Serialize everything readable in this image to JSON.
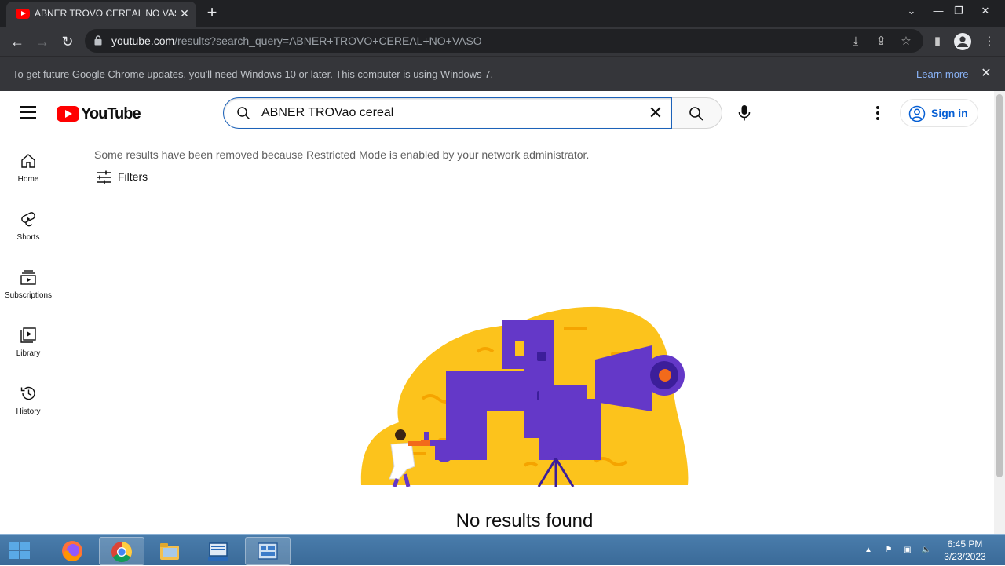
{
  "browser": {
    "tab_title": "ABNER TROVO CEREAL NO VASO",
    "url_domain": "youtube.com",
    "url_path": "/results?search_query=ABNER+TROVO+CEREAL+NO+VASO",
    "infobar_message": "To get future Google Chrome updates, you'll need Windows 10 or later. This computer is using Windows 7.",
    "infobar_link": "Learn more"
  },
  "youtube": {
    "logo_text": "YouTube",
    "search_value": "ABNER TROVao cereal",
    "signin_label": "Sign in",
    "nav": [
      {
        "label": "Home",
        "icon": "home-icon"
      },
      {
        "label": "Shorts",
        "icon": "shorts-icon"
      },
      {
        "label": "Subscriptions",
        "icon": "subscriptions-icon"
      },
      {
        "label": "Library",
        "icon": "library-icon"
      },
      {
        "label": "History",
        "icon": "history-icon"
      }
    ],
    "restricted_message": "Some results have been removed because Restricted Mode is enabled by your network administrator.",
    "filters_label": "Filters",
    "no_results": "No results found"
  },
  "taskbar": {
    "apps": [
      "firefox-icon",
      "chrome-icon",
      "file-explorer-icon",
      "text-editor-icon",
      "control-panel-icon"
    ],
    "time": "6:45 PM",
    "date": "3/23/2023"
  },
  "colors": {
    "brand_red": "#ff0000",
    "link_blue": "#065fd4",
    "illustration_yellow": "#fcc31c",
    "illustration_purple": "#6438c8"
  }
}
